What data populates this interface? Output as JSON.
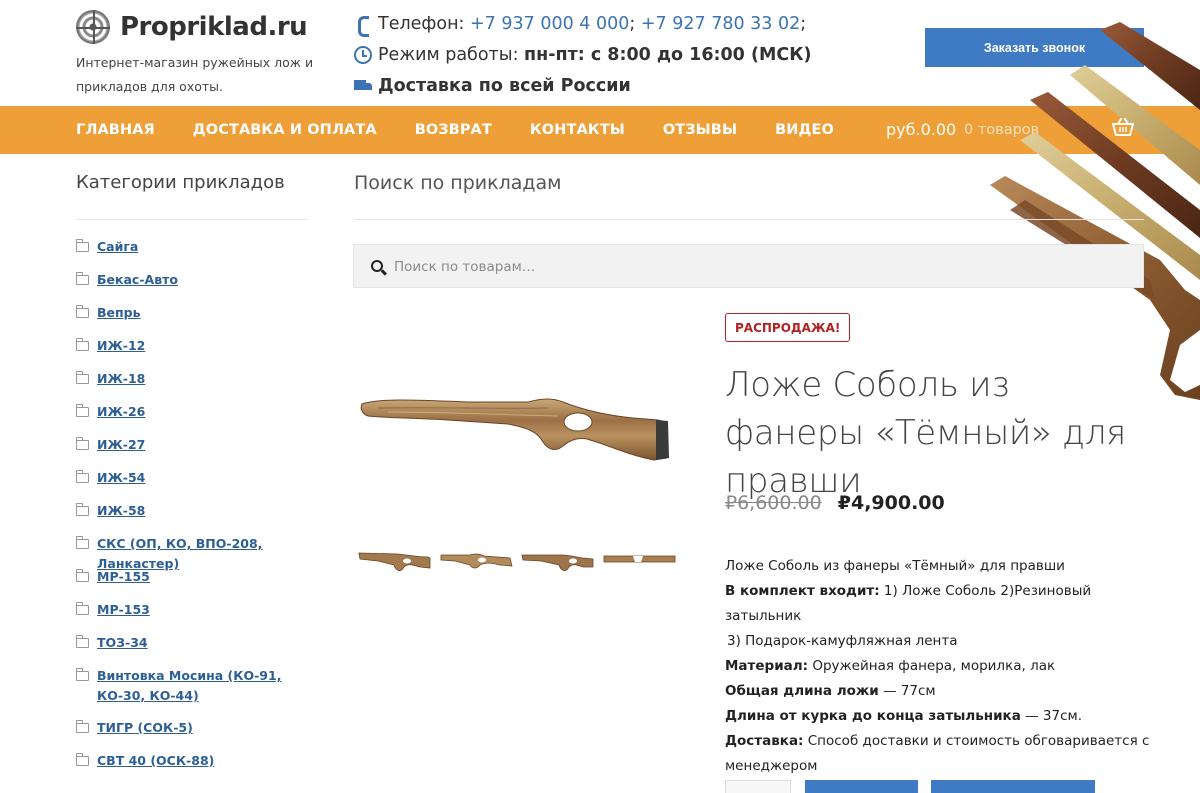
{
  "header": {
    "logo_text": "Propriklad.ru",
    "tagline": "Интернет-магазин ружейных лож и прикладов для охоты.",
    "phone_label": "Телефон:",
    "phone1": "+7 937 000 4 000",
    "phone_sep": ";",
    "phone2": "+7 927 780 33 02",
    "phone_end": ";",
    "hours_label": "Режим работы:",
    "hours_value": "пн-пт: с 8:00 до 16:00 (МСК)",
    "delivery": "Доставка по всей России",
    "callback_label": "Заказать звонок"
  },
  "nav": {
    "items": [
      "ГЛАВНАЯ",
      "ДОСТАВКА И ОПЛАТА",
      "ВОЗВРАТ",
      "КОНТАКТЫ",
      "ОТЗЫВЫ",
      "ВИДЕО"
    ],
    "cart_amount": "руб.0.00",
    "cart_count": "0 товаров"
  },
  "sidebar": {
    "title": "Категории прикладов",
    "categories": [
      "Сайга",
      "Бекас-Авто",
      "Вепрь",
      "ИЖ-12",
      "ИЖ-18",
      "ИЖ-26",
      "ИЖ-27",
      "ИЖ-54",
      "ИЖ-58",
      "СКС (ОП, КО, ВПО-208, Ланкастер)",
      "МР-155",
      "МР-153",
      "ТОЗ-34",
      "Винтовка Мосина (КО-91, КО-30, КО-44)",
      "ТИГР (СОК-5)",
      "СВТ 40 (ОСК-88)"
    ]
  },
  "main": {
    "search_title": "Поиск по прикладам",
    "search_placeholder": "Поиск по товарам…"
  },
  "product": {
    "sale_badge": "РАСПРОДАЖА!",
    "title": "Ложе Соболь из фанеры «Тёмный» для правши",
    "price_old": "₽6,600.00",
    "price_new": "₽4,900.00",
    "desc_intro": "Ложе Соболь из фанеры «Тёмный» для правши",
    "kit_label": "В комплект входит:",
    "kit_value": " 1) Ложе Соболь  2)Резиновый затыльник",
    "kit_value2": " 3) Подарок-камуфляжная лента",
    "material_label": "Материал:",
    "material_value": " Оружейная фанера, морилка, лак",
    "length_label": "Общая длина ложи",
    "length_value": " — 77см",
    "trigger_label": "Длина от курка до конца затыльника",
    "trigger_value": " — 37см.",
    "delivery_label": "Доставка:",
    "delivery_value": " Способ доставки и стоимость обговаривается с менеджером"
  },
  "colors": {
    "accent_orange": "#ef9f37",
    "link_blue": "#3b73b3",
    "button_blue": "#3f7bc4",
    "sale_red": "#b22222"
  }
}
